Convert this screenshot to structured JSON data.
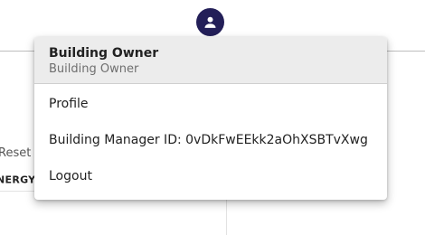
{
  "header": {
    "avatar_icon": "account-circle-icon",
    "avatar_color": "#231f58"
  },
  "background": {
    "reset_text": "Reset S",
    "energy_star_text": "NERGY STAR",
    "energy_star_mark": "®"
  },
  "user_menu": {
    "name": "Building Owner",
    "role": "Building Owner",
    "items": [
      {
        "label": "Profile"
      },
      {
        "label": "Building Manager ID: 0vDkFwEEkk2aOhXSBTvXwg"
      },
      {
        "label": "Logout"
      }
    ]
  }
}
